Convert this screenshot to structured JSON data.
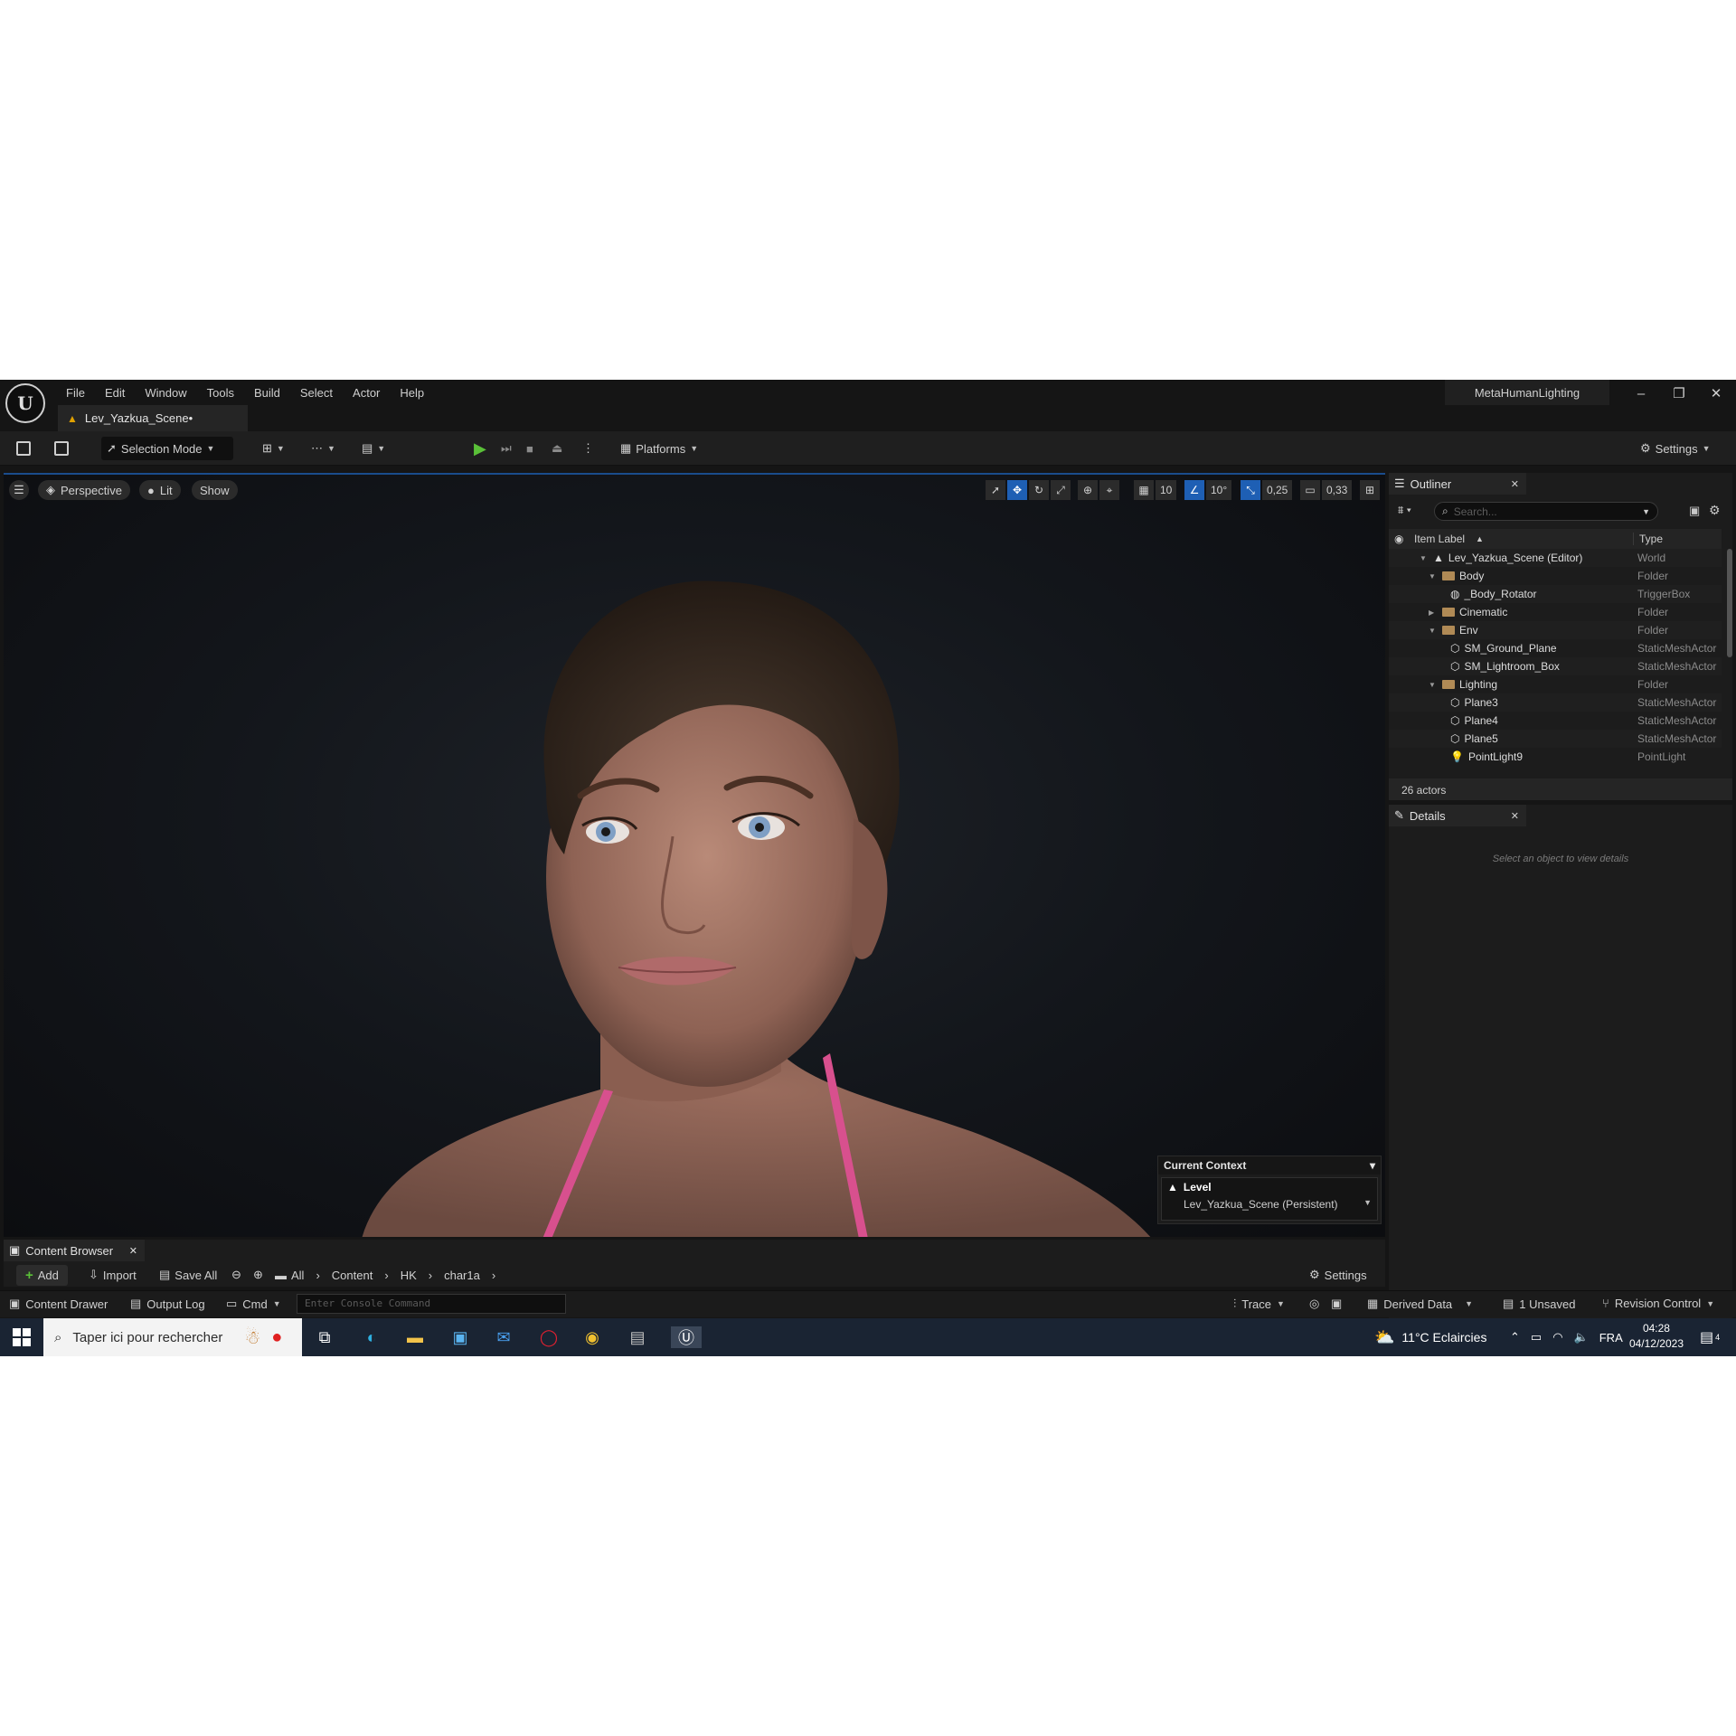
{
  "menu": {
    "items": [
      "File",
      "Edit",
      "Window",
      "Tools",
      "Build",
      "Select",
      "Actor",
      "Help"
    ],
    "project_name": "MetaHumanLighting",
    "logo_text": "U"
  },
  "document_tab": {
    "label": "Lev_Yazkua_Scene•"
  },
  "toolbar": {
    "selection_mode": "Selection Mode",
    "platforms": "Platforms",
    "settings": "Settings"
  },
  "viewport": {
    "perspective": "Perspective",
    "lit": "Lit",
    "show": "Show",
    "grid_snap": "10",
    "angle_snap": "10°",
    "scale_snap": "0,25",
    "camera_speed": "0,33",
    "context": {
      "title": "Current Context",
      "level_label": "Level",
      "level_value": "Lev_Yazkua_Scene (Persistent)"
    }
  },
  "outliner": {
    "tab_label": "Outliner",
    "search_placeholder": "Search...",
    "col_label": "Item Label",
    "col_type": "Type",
    "rows": [
      {
        "label": "Lev_Yazkua_Scene (Editor)",
        "type": "World"
      },
      {
        "label": "Body",
        "type": "Folder"
      },
      {
        "label": "_Body_Rotator",
        "type": "TriggerBox"
      },
      {
        "label": "Cinematic",
        "type": "Folder"
      },
      {
        "label": "Env",
        "type": "Folder"
      },
      {
        "label": "SM_Ground_Plane",
        "type": "StaticMeshActor"
      },
      {
        "label": "SM_Lightroom_Box",
        "type": "StaticMeshActor"
      },
      {
        "label": "Lighting",
        "type": "Folder"
      },
      {
        "label": "Plane3",
        "type": "StaticMeshActor"
      },
      {
        "label": "Plane4",
        "type": "StaticMeshActor"
      },
      {
        "label": "Plane5",
        "type": "StaticMeshActor"
      },
      {
        "label": "PointLight9",
        "type": "PointLight"
      }
    ],
    "actor_count": "26 actors"
  },
  "details": {
    "tab_label": "Details",
    "empty_text": "Select an object to view details"
  },
  "content_browser": {
    "tab_label": "Content Browser",
    "add": "Add",
    "import": "Import",
    "save_all": "Save All",
    "path": [
      "All",
      "Content",
      "HK",
      "char1a"
    ],
    "settings": "Settings"
  },
  "statusbar": {
    "content_drawer": "Content Drawer",
    "output_log": "Output Log",
    "cmd": "Cmd",
    "console_placeholder": "Enter Console Command",
    "trace": "Trace",
    "derived_data": "Derived Data",
    "unsaved": "1 Unsaved",
    "revision_control": "Revision Control"
  },
  "taskbar": {
    "search_placeholder": "Taper ici pour rechercher",
    "weather": "11°C  Eclaircies",
    "language": "FRA",
    "time": "04:28",
    "date": "04/12/2023",
    "notification_count": "4"
  }
}
